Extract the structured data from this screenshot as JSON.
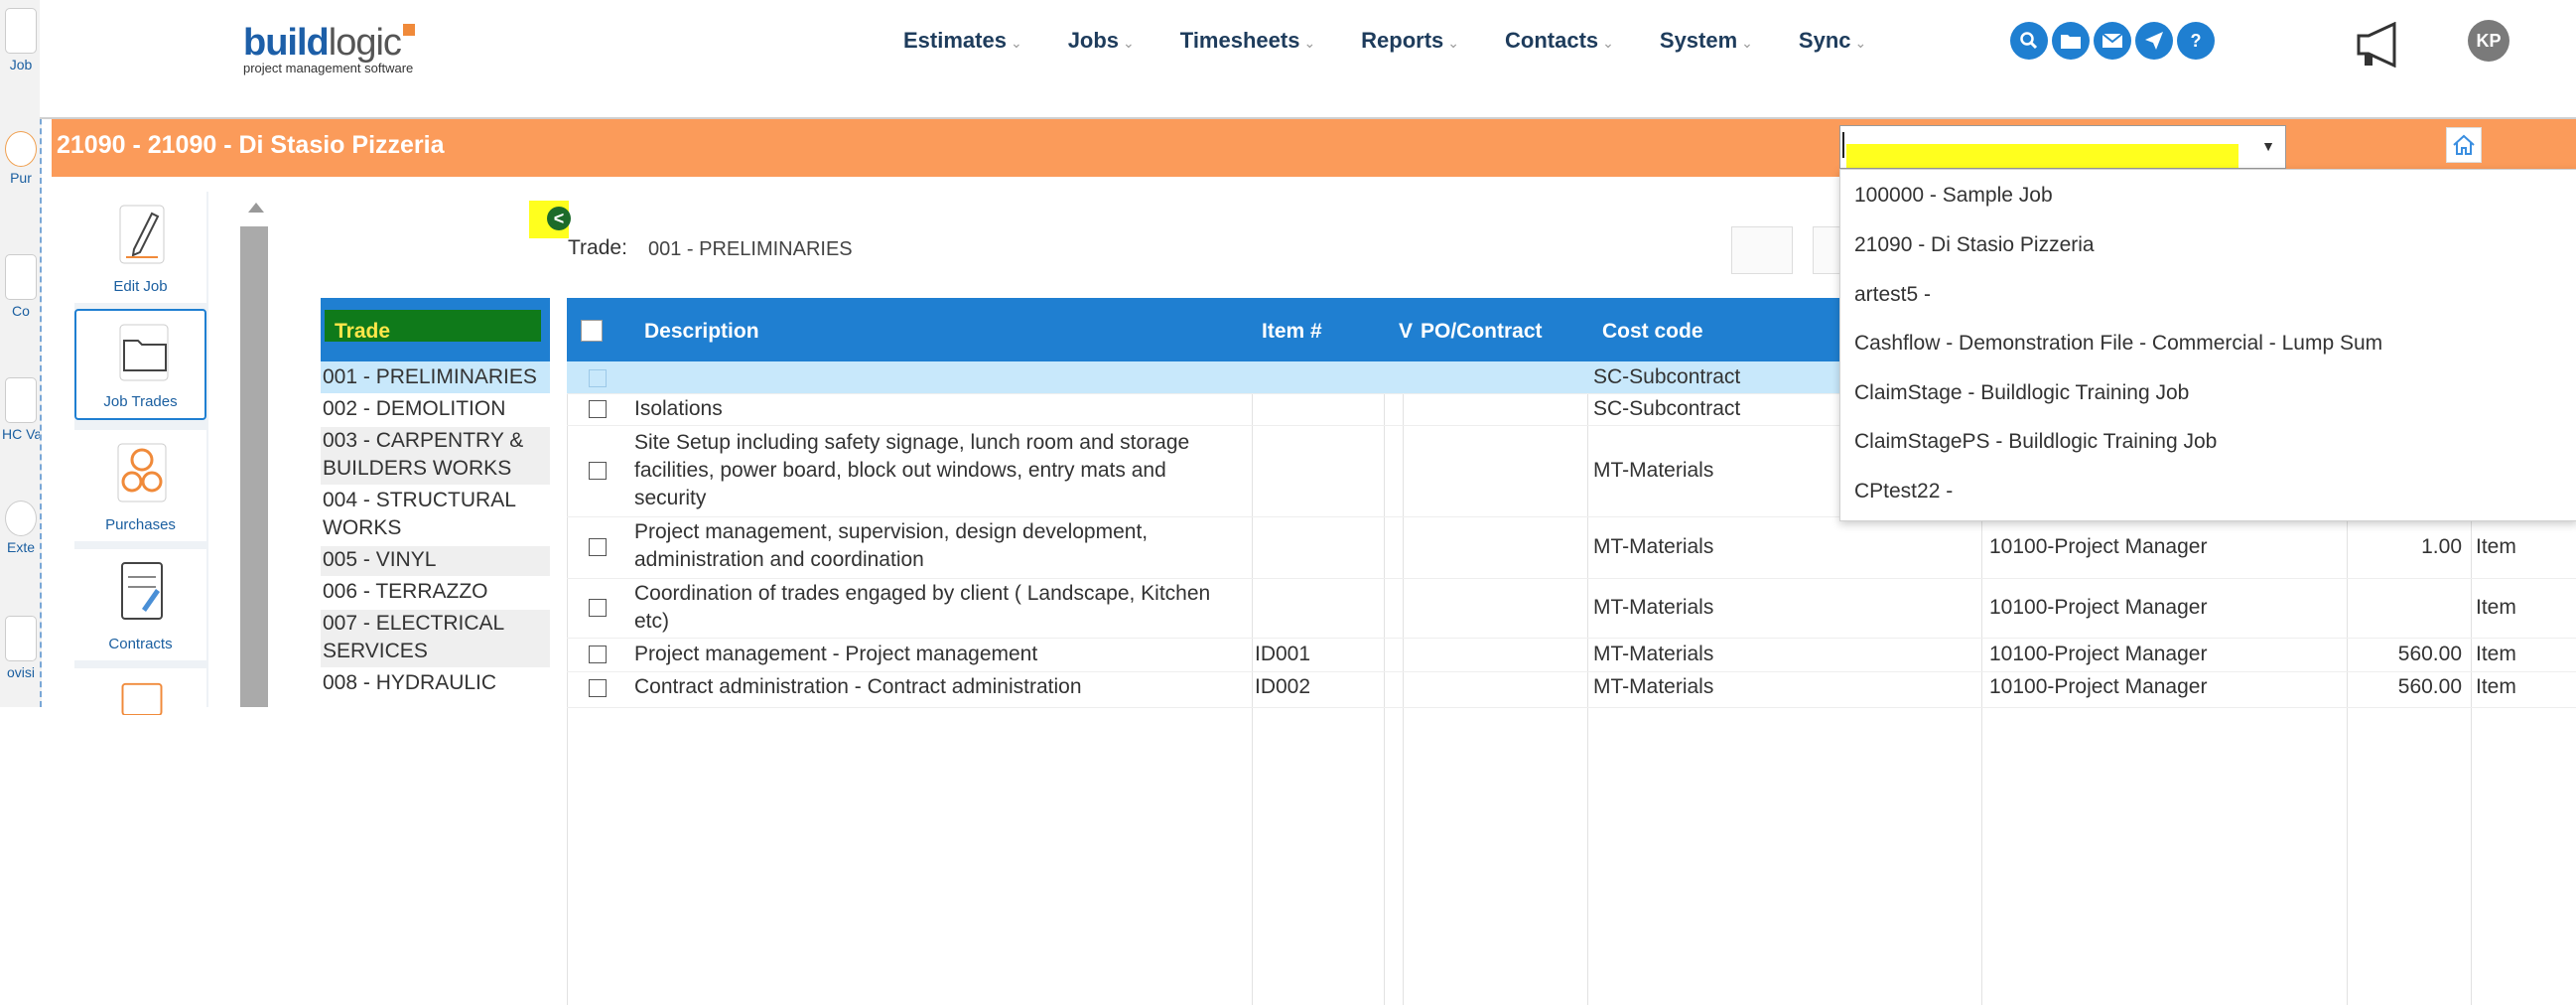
{
  "left_strip": {
    "items": [
      "Job",
      "Pur",
      "Co",
      "HC Va",
      "Exte",
      "ovisi"
    ]
  },
  "header": {
    "logo_main": "build",
    "logo_second": "logic",
    "logo_tagline": "project management software",
    "nav": [
      "Estimates",
      "Jobs",
      "Timesheets",
      "Reports",
      "Contacts",
      "System",
      "Sync"
    ],
    "quick_icons": [
      "search-icon",
      "folder-icon",
      "mail-icon",
      "send-icon",
      "help-icon"
    ],
    "help_glyph": "?",
    "avatar_initials": "KP"
  },
  "banner": {
    "title": "21090 - 21090 - Di Stasio Pizzeria"
  },
  "job_picker": {
    "options": [
      "100000 - Sample Job",
      "21090 - Di Stasio Pizzeria",
      "artest5 -",
      "Cashflow - Demonstration File - Commercial - Lump Sum",
      "ClaimStage - Buildlogic Training Job",
      "ClaimStagePS - Buildlogic Training Job",
      "CPtest22 -"
    ]
  },
  "tiles": [
    "Edit Job",
    "Job Trades",
    "Purchases",
    "Contracts"
  ],
  "trade_filter": {
    "label": "Trade:",
    "value": "001 - PRELIMINARIES",
    "collapse_glyph": "<"
  },
  "trade_list": {
    "header": "Trade",
    "items": [
      [
        "001 - PRELIMINARIES"
      ],
      [
        "002 - DEMOLITION"
      ],
      [
        "003 - CARPENTRY &",
        "BUILDERS WORKS"
      ],
      [
        "004 - STRUCTURAL",
        "WORKS"
      ],
      [
        "005 - VINYL"
      ],
      [
        "006 - TERRAZZO"
      ],
      [
        "007 - ELECTRICAL",
        "SERVICES"
      ],
      [
        "008 - HYDRAULIC"
      ]
    ]
  },
  "grid": {
    "columns": [
      "Description",
      "Item #",
      "V",
      "PO/Contract",
      "Cost code"
    ],
    "rows": [
      {
        "desc": [
          ""
        ],
        "item": "",
        "cost": "SC-Subcontract",
        "cc": "",
        "qty": "",
        "unit": ""
      },
      {
        "desc": [
          "Isolations"
        ],
        "item": "",
        "cost": "SC-Subcontract",
        "cc": "",
        "qty": "",
        "unit": ""
      },
      {
        "desc": [
          "Site Setup including safety signage, lunch room and storage",
          "facilities, power board, block out windows, entry mats and",
          "security"
        ],
        "item": "",
        "cost": "MT-Materials",
        "cc": "",
        "qty": "",
        "unit": ""
      },
      {
        "desc": [
          "Project management, supervision, design development,",
          "administration and coordination"
        ],
        "item": "",
        "cost": "MT-Materials",
        "cc": "10100-Project Manager",
        "qty": "1.00",
        "unit": "Item"
      },
      {
        "desc": [
          "Coordination of trades engaged by client ( Landscape, Kitchen",
          "etc)"
        ],
        "item": "",
        "cost": "MT-Materials",
        "cc": "10100-Project Manager",
        "qty": "",
        "unit": "Item"
      },
      {
        "desc": [
          "Project management - Project management"
        ],
        "item": "ID001",
        "cost": "MT-Materials",
        "cc": "10100-Project Manager",
        "qty": "560.00",
        "unit": "Item"
      },
      {
        "desc": [
          "Contract administration - Contract administration"
        ],
        "item": "ID002",
        "cost": "MT-Materials",
        "cc": "10100-Project Manager",
        "qty": "560.00",
        "unit": "Item"
      }
    ]
  },
  "colors": {
    "accent_blue": "#1f7fd1",
    "banner_orange": "#fb9b5a",
    "highlight_yellow": "#ffff1e",
    "selected_row": "#c8e8fb"
  }
}
